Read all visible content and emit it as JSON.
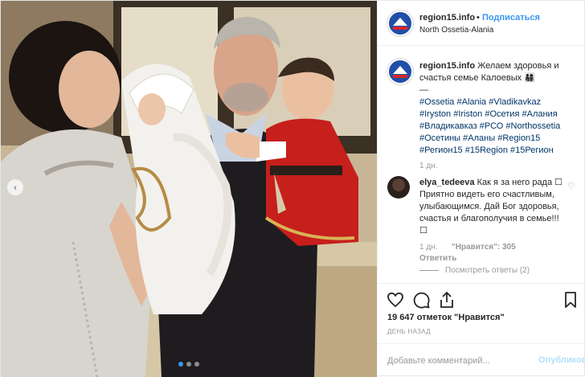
{
  "post": {
    "author": "region15.info",
    "separator": "•",
    "follow_label": "Подписаться",
    "location": "North Ossetia-Alania"
  },
  "caption": {
    "author": "region15.info",
    "text": "Желаем здоровья и счастья семье Калоевых 👨‍👩‍👧‍👦",
    "divider": "—",
    "hashtags": [
      "#Ossetia",
      "#Alania",
      "#Vladikavkaz",
      "#Iryston",
      "#Iriston",
      "#Осетия",
      "#Алания",
      "#Владикавказ",
      "#РСО",
      "#Northossetia",
      "#Осетины",
      "#Аланы",
      "#Region15",
      "#Регион15",
      "#15Region",
      "#15Регион"
    ],
    "age": "1 дн."
  },
  "comment": {
    "author": "elya_tedeeva",
    "text": "Как я за него рада ☐ Приятно видеть его счастливым, улыбающимся. Дай Бог здоровья, счастья и благополучия в семье!!! ☐",
    "age": "1 дн.",
    "likes": "\"Нравится\": 305",
    "reply_label": "Ответить",
    "see_replies": "Посмотреть ответы (2)"
  },
  "actions": {
    "likes_count": "19 647 отметок \"Нравится\"",
    "timestamp": "ДЕНЬ НАЗАД"
  },
  "add_comment": {
    "placeholder": "Добавьте комментарий...",
    "publish_label": "Опубликовать"
  },
  "carousel": {
    "slides": 3,
    "active": 0
  },
  "colors": {
    "accent": "#3897f0",
    "hashtag": "#003569",
    "muted": "#999999",
    "publish_disabled": "#b2dffc"
  }
}
